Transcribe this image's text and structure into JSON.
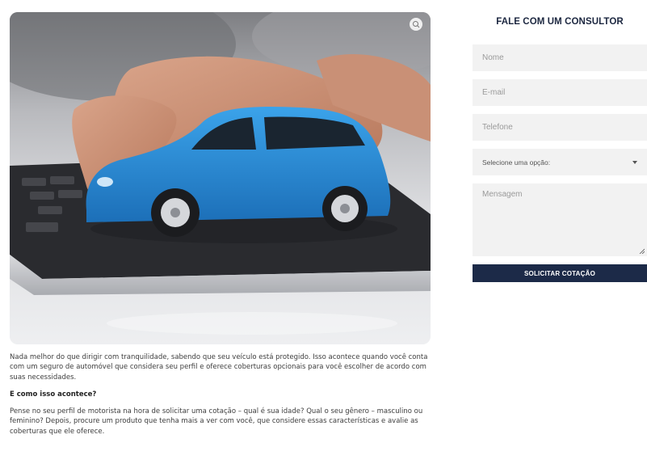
{
  "article": {
    "paragraph1": "Nada melhor do que dirigir com tranquilidade, sabendo que seu veículo está protegido. Isso acontece quando você conta com um seguro de automóvel que considera seu perfil e oferece coberturas opcionais para você escolher de acordo com suas necessidades.",
    "heading": "E como isso acontece?",
    "paragraph2": "Pense no seu perfil de motorista na hora de solicitar uma cotação – qual é sua idade? Qual o seu gênero – masculino ou feminino? Depois, procure um produto que tenha mais a ver com você, que considere essas características e avalie as coberturas que ele oferece."
  },
  "form": {
    "title": "FALE COM UM CONSULTOR",
    "name_placeholder": "Nome",
    "email_placeholder": "E-mail",
    "phone_placeholder": "Telefone",
    "select_value": "Selecione uma opção:",
    "message_placeholder": "Mensagem",
    "submit_label": "SOLICITAR COTAÇÃO"
  },
  "hero": {
    "zoom_icon": "zoom-icon",
    "car_color": "#2f8fd8"
  },
  "colors": {
    "accent": "#1c2a48",
    "field_bg": "#f2f2f2"
  }
}
